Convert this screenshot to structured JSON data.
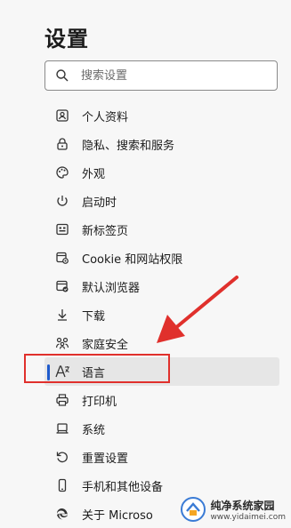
{
  "page": {
    "title": "设置"
  },
  "search": {
    "placeholder": "搜索设置"
  },
  "nav": {
    "items": [
      {
        "label": "个人资料",
        "icon": "profile-icon"
      },
      {
        "label": "隐私、搜索和服务",
        "icon": "lock-icon"
      },
      {
        "label": "外观",
        "icon": "palette-icon"
      },
      {
        "label": "启动时",
        "icon": "power-icon"
      },
      {
        "label": "新标签页",
        "icon": "new-tab-icon"
      },
      {
        "label": "Cookie 和网站权限",
        "icon": "site-permissions-icon"
      },
      {
        "label": "默认浏览器",
        "icon": "default-browser-icon"
      },
      {
        "label": "下载",
        "icon": "download-icon"
      },
      {
        "label": "家庭安全",
        "icon": "family-icon"
      },
      {
        "label": "语言",
        "icon": "language-icon",
        "selected": true
      },
      {
        "label": "打印机",
        "icon": "printer-icon"
      },
      {
        "label": "系统",
        "icon": "system-icon"
      },
      {
        "label": "重置设置",
        "icon": "reset-icon"
      },
      {
        "label": "手机和其他设备",
        "icon": "phone-icon"
      },
      {
        "label": "关于 Microso",
        "icon": "edge-logo-icon"
      }
    ]
  },
  "annotation": {
    "highlight_color": "#e0302c"
  },
  "watermark": {
    "title": "纯净系统家园",
    "url": "www.yidaimei.com"
  },
  "colors": {
    "accent": "#1f5bcc",
    "selected_bg": "#e6e6e6"
  }
}
